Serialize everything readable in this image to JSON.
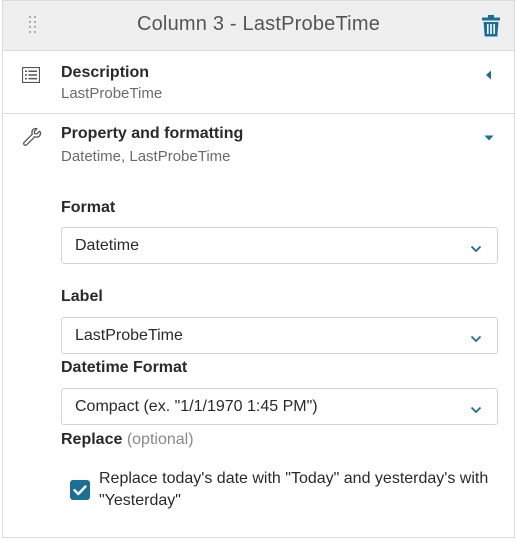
{
  "header": {
    "title": "Column 3 - LastProbeTime"
  },
  "description": {
    "title": "Description",
    "subtitle": "LastProbeTime"
  },
  "property": {
    "title": "Property and formatting",
    "subtitle": "Datetime, LastProbeTime"
  },
  "fields": {
    "format": {
      "label": "Format",
      "value": "Datetime"
    },
    "label": {
      "label": "Label",
      "value": "LastProbeTime"
    },
    "datetime_format": {
      "label": "Datetime Format",
      "value": "Compact (ex. \"1/1/1970 1:45 PM\")"
    },
    "replace": {
      "label": "Replace",
      "optional": "(optional)",
      "checkbox_label": "Replace today's date with \"Today\" and yesterday's with \"Yesterday\"",
      "checked": true
    }
  },
  "colors": {
    "accent": "#1a6f95",
    "header_bg": "#efefef",
    "border": "#dcdcdc"
  },
  "icons": {
    "drag": "drag-handle-icon",
    "delete": "trash-icon",
    "description": "list-icon",
    "property": "wrench-icon",
    "collapsed": "caret-left-icon",
    "expanded": "caret-down-icon",
    "dropdown": "chevron-down-icon",
    "check": "checkmark-icon"
  }
}
